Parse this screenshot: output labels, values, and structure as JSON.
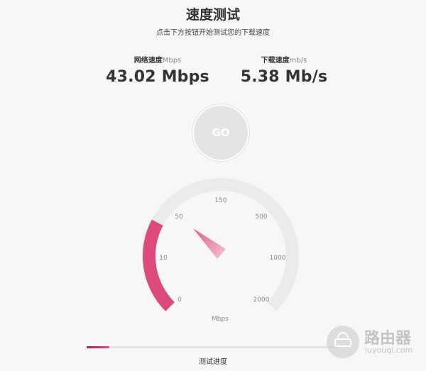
{
  "header": {
    "title": "速度测试",
    "subtitle": "点击下方按钮开始测试您的下载速度"
  },
  "stats": {
    "network": {
      "label": "网络速度",
      "unit": "Mbps",
      "value": "43.02 Mbps"
    },
    "download": {
      "label": "下载速度",
      "unit": "mb/s",
      "value": "5.38 Mb/s"
    }
  },
  "go_button": {
    "label": "GO"
  },
  "gauge": {
    "ticks": [
      "0",
      "10",
      "50",
      "150",
      "500",
      "1000",
      "2000"
    ],
    "unit": "Mbps",
    "fill_fraction": 0.27,
    "colors": {
      "track": "#ebebeb",
      "fill": "#dd4b7b",
      "needle": "#e05a88"
    }
  },
  "progress": {
    "label": "测试进度",
    "fraction": 0.09
  },
  "watermark": {
    "name": "路由器",
    "url": "luyouqi.com"
  }
}
